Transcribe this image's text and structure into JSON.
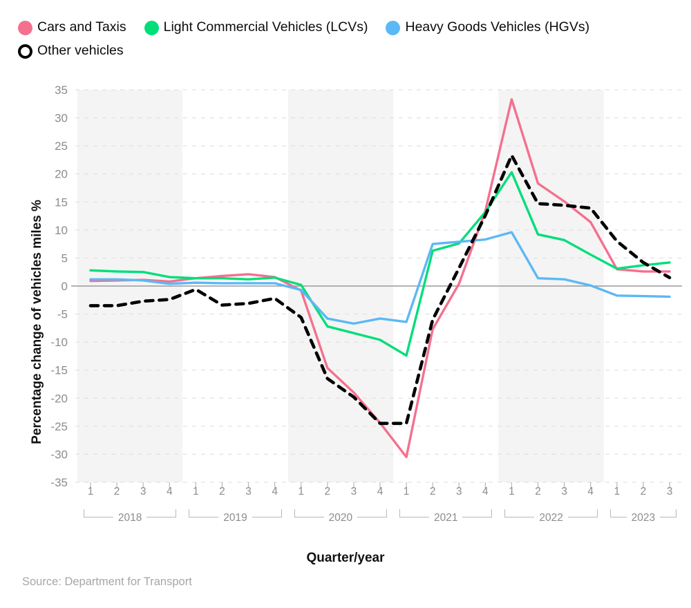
{
  "legend": {
    "items": [
      {
        "label": "Cars and Taxis",
        "color": "#F4708E",
        "style": "solid"
      },
      {
        "label": "Light Commercial Vehicles (LCVs)",
        "color": "#00DE7A",
        "style": "solid"
      },
      {
        "label": "Heavy Goods Vehicles (HGVs)",
        "color": "#5CB8F5",
        "style": "solid"
      },
      {
        "label": "Other vehicles",
        "color": "#000000",
        "style": "dashed-hollow"
      }
    ]
  },
  "source": "Source: Department for Transport",
  "chart_data": {
    "type": "line",
    "title": "",
    "xlabel": "Quarter/year",
    "ylabel": "Percentage change of vehicles miles %",
    "ylim": [
      -35,
      35
    ],
    "ytick_step": 5,
    "yticks": [
      35,
      30,
      25,
      20,
      15,
      10,
      5,
      0,
      -5,
      -10,
      -15,
      -20,
      -25,
      -30,
      -35
    ],
    "grid": true,
    "legend_position": "top-left",
    "zero_line": true,
    "shaded_years": [
      "2018",
      "2020",
      "2022"
    ],
    "categories": [
      "2018 Q1",
      "2018 Q2",
      "2018 Q3",
      "2018 Q4",
      "2019 Q1",
      "2019 Q2",
      "2019 Q3",
      "2019 Q4",
      "2020 Q1",
      "2020 Q2",
      "2020 Q3",
      "2020 Q4",
      "2021 Q1",
      "2021 Q2",
      "2021 Q3",
      "2021 Q4",
      "2022 Q1",
      "2022 Q2",
      "2022 Q3",
      "2022 Q4",
      "2023 Q1",
      "2023 Q2",
      "2023 Q3"
    ],
    "quarter_ticks": [
      "1",
      "2",
      "3",
      "4",
      "1",
      "2",
      "3",
      "4",
      "1",
      "2",
      "3",
      "4",
      "1",
      "2",
      "3",
      "4",
      "1",
      "2",
      "3",
      "4",
      "1",
      "2",
      "3"
    ],
    "years": [
      {
        "label": "2018",
        "start_index": 0,
        "end_index": 3,
        "shaded": true
      },
      {
        "label": "2019",
        "start_index": 4,
        "end_index": 7,
        "shaded": false
      },
      {
        "label": "2020",
        "start_index": 8,
        "end_index": 11,
        "shaded": true
      },
      {
        "label": "2021",
        "start_index": 12,
        "end_index": 15,
        "shaded": false
      },
      {
        "label": "2022",
        "start_index": 16,
        "end_index": 19,
        "shaded": true
      },
      {
        "label": "2023",
        "start_index": 20,
        "end_index": 22,
        "shaded": false
      }
    ],
    "series": [
      {
        "name": "Cars and Taxis",
        "color": "#F4708E",
        "dash": "none",
        "values": [
          0.9,
          1.0,
          1.1,
          0.8,
          1.4,
          1.8,
          2.1,
          1.6,
          -0.8,
          -14.6,
          -19.0,
          -24.4,
          -30.5,
          -7.7,
          0.4,
          13.4,
          33.3,
          18.3,
          15.1,
          11.4,
          3.0,
          2.6,
          2.6
        ]
      },
      {
        "name": "Light Commercial Vehicles (LCVs)",
        "color": "#00DE7A",
        "dash": "none",
        "values": [
          2.8,
          2.6,
          2.5,
          1.6,
          1.4,
          1.4,
          1.2,
          1.5,
          0.2,
          -7.2,
          -8.4,
          -9.6,
          -12.4,
          6.3,
          7.6,
          13.2,
          20.3,
          9.2,
          8.2,
          5.6,
          3.1,
          3.7,
          4.2
        ]
      },
      {
        "name": "Heavy Goods Vehicles (HGVs)",
        "color": "#5CB8F5",
        "dash": "none",
        "values": [
          1.2,
          1.2,
          1.0,
          0.4,
          0.6,
          0.5,
          0.5,
          0.5,
          -0.7,
          -5.8,
          -6.7,
          -5.8,
          -6.4,
          7.5,
          7.9,
          8.3,
          9.6,
          1.4,
          1.2,
          0.1,
          -1.7,
          -1.8,
          -1.9
        ]
      },
      {
        "name": "Other vehicles",
        "color": "#000000",
        "dash": "dashed",
        "values": [
          -3.5,
          -3.5,
          -2.7,
          -2.4,
          -0.6,
          -3.4,
          -3.1,
          -2.2,
          -5.6,
          -16.5,
          -19.8,
          -24.5,
          -24.5,
          -6.0,
          3.2,
          12.6,
          23.3,
          14.7,
          14.4,
          13.9,
          8.0,
          4.2,
          1.5
        ]
      }
    ]
  }
}
